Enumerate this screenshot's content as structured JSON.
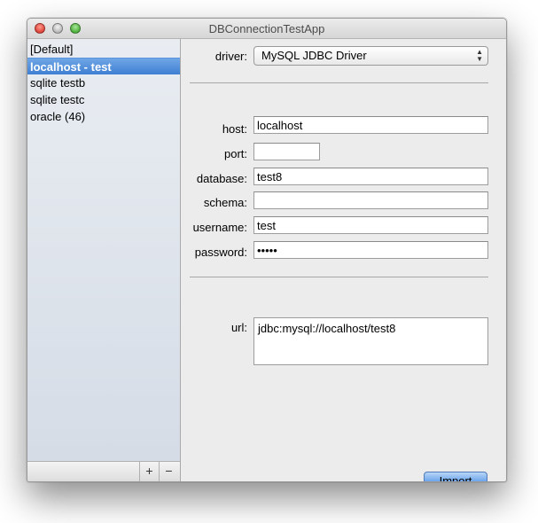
{
  "window": {
    "title": "DBConnectionTestApp"
  },
  "sidebar": {
    "items": [
      {
        "label": "[Default]",
        "selected": false
      },
      {
        "label": "localhost - test",
        "selected": true
      },
      {
        "label": "sqlite testb",
        "selected": false
      },
      {
        "label": "sqlite testc",
        "selected": false
      },
      {
        "label": "oracle (46)",
        "selected": false
      }
    ],
    "add_label": "+",
    "remove_label": "−"
  },
  "form": {
    "driver_label": "driver:",
    "driver_value": "MySQL JDBC Driver",
    "host_label": "host:",
    "host_value": "localhost",
    "port_label": "port:",
    "port_value": "",
    "database_label": "database:",
    "database_value": "test8",
    "schema_label": "schema:",
    "schema_value": "",
    "username_label": "username:",
    "username_value": "test",
    "password_label": "password:",
    "password_value": "•••••",
    "url_label": "url:",
    "url_value": "jdbc:mysql://localhost/test8",
    "import_label": "Import"
  },
  "colors": {
    "selection": "#3f7fd2",
    "default_button": "#6aa3ea"
  }
}
